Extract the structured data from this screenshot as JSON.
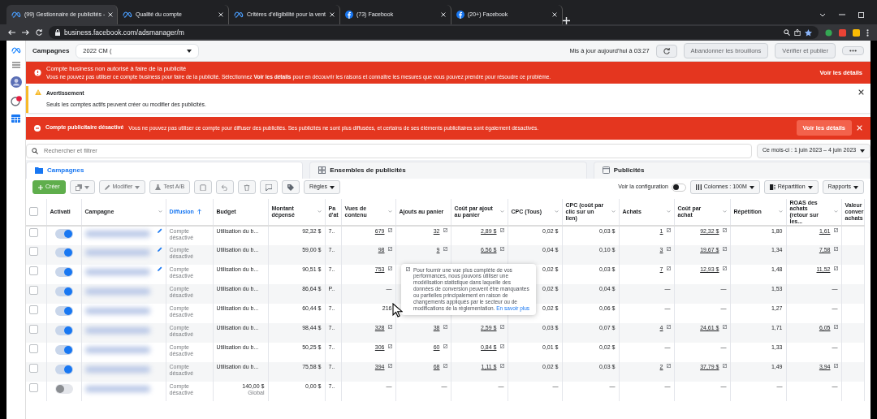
{
  "browser": {
    "tabs": [
      {
        "title": "(99) Gestionnaire de publicités -",
        "kind": "meta",
        "selected": true
      },
      {
        "title": "Qualité du compte",
        "kind": "meta",
        "selected": false
      },
      {
        "title": "Critères d'éligibilité pour la vent",
        "kind": "meta",
        "selected": false
      },
      {
        "title": "(73) Facebook",
        "kind": "facebook",
        "selected": false
      },
      {
        "title": "(20+) Facebook",
        "kind": "facebook",
        "selected": false
      }
    ],
    "url": "business.facebook.com/adsmanager/m"
  },
  "header": {
    "title": "Campagnes",
    "account": "2022 CM (",
    "updated": "Mis à jour aujourd'hui à 03:27",
    "buttons": [
      {
        "label": "Abandonner les brouillons",
        "disabled": true
      },
      {
        "label": "Vérifier et publier",
        "disabled": true
      }
    ]
  },
  "alerts": [
    {
      "kind": "error",
      "title": "Compte business non autorisé à faire de la publicité",
      "text": "Vous ne pouvez pas utiliser ce compte business pour faire de la publicité. Sélectionnez **Voir les détails** pour en découvrir les raisons et connaître les mesures que vous pouvez prendre pour résoudre ce problème.",
      "action": "Voir les détails",
      "closable": false
    },
    {
      "kind": "warning",
      "title": "Avertissement",
      "text": "Seuls les comptes actifs peuvent créer ou modifier des publicités.",
      "closable": true
    },
    {
      "kind": "error_inline",
      "title": "Compte publicitaire désactivé",
      "text": "Vous ne pouvez pas utiliser ce compte pour diffuser des publicités. Ses publicités ne sont plus diffusées, et certains de ses éléments publicitaires sont également désactivés.",
      "action": "Voir les détails",
      "closable": true
    }
  ],
  "search": {
    "placeholder": "Rechercher et filtrer",
    "date_range": "Ce mois-ci : 1 juin 2023 – 4 juin 2023"
  },
  "level_tabs": [
    {
      "label": "Campagnes",
      "kind": "folder",
      "selected": true
    },
    {
      "label": "Ensembles de publicités",
      "kind": "grid",
      "selected": false
    },
    {
      "label": "Publicités",
      "kind": "page",
      "selected": false
    }
  ],
  "toolbar": {
    "create": {
      "label": "Créer",
      "disabled": true
    },
    "edit": {
      "label": "Modifier",
      "disabled": true
    },
    "ab_test": {
      "label": "Test A/B",
      "disabled": true
    },
    "rules": "Règles",
    "config": {
      "label": "Voir la configuration",
      "on": false
    },
    "columns": "Colonnes : 100M",
    "breakdown": "Répartition",
    "reports": "Rapports"
  },
  "table": {
    "all_selected": false,
    "columns": [
      {
        "label": "Activati",
        "menu": false,
        "sorted": false
      },
      {
        "label": "Campagne",
        "menu": true,
        "sorted": false
      },
      {
        "label": "Diffusion",
        "menu": false,
        "sorted": true
      },
      {
        "label": "Budget",
        "menu": false,
        "sorted": false
      },
      {
        "label": "Montant dépensé",
        "menu": true,
        "sorted": false
      },
      {
        "label": "Pa d'at",
        "menu": false,
        "sorted": false
      },
      {
        "label": "Vues de contenu",
        "menu": true,
        "sorted": false
      },
      {
        "label": "Ajouts au panier",
        "menu": false,
        "sorted": false
      },
      {
        "label": "Coût par ajout au panier",
        "menu": true,
        "sorted": false
      },
      {
        "label": "CPC (Tous)",
        "menu": true,
        "sorted": false
      },
      {
        "label": "CPC (coût par clic sur un lien)",
        "menu": true,
        "sorted": false
      },
      {
        "label": "Achats",
        "menu": true,
        "sorted": false
      },
      {
        "label": "Coût par achat",
        "menu": true,
        "sorted": false
      },
      {
        "label": "Répétition",
        "menu": true,
        "sorted": false
      },
      {
        "label": "ROAS des achats (retour sur les...",
        "menu": true,
        "sorted": false
      },
      {
        "label": "Valeur conver achats",
        "menu": false,
        "sorted": false
      }
    ],
    "rows": [
      {
        "selected": false,
        "on": true,
        "draft": true,
        "cells": [
          null,
          null,
          "Compte désactivé",
          "Utilisation du b...",
          "92,32 $",
          "7..",
          {
            "text": "679",
            "modeled": true
          },
          {
            "text": "32",
            "modeled": true
          },
          {
            "text": "2,89 $",
            "modeled": true
          },
          "0,02 $",
          "0,03 $",
          {
            "text": "1",
            "modeled": true
          },
          {
            "text": "92,32 $",
            "modeled": true
          },
          "1,80",
          {
            "text": "1,61",
            "modeled": true
          },
          null
        ]
      },
      {
        "selected": false,
        "on": true,
        "draft": true,
        "cells": [
          null,
          null,
          "Compte désactivé",
          "Utilisation du b...",
          "59,00 $",
          "7..",
          {
            "text": "98",
            "modeled": true
          },
          {
            "text": "9",
            "modeled": true
          },
          {
            "text": "6,56 $",
            "modeled": true
          },
          "0,04 $",
          "0,10 $",
          {
            "text": "3",
            "modeled": true
          },
          {
            "text": "19,67 $",
            "modeled": true
          },
          "1,34",
          {
            "text": "7,58",
            "modeled": true
          },
          null
        ]
      },
      {
        "selected": false,
        "on": true,
        "draft": true,
        "cells": [
          null,
          null,
          "Compte désactivé",
          "Utilisation du b...",
          "90,51 $",
          "7..",
          {
            "text": "753",
            "modeled": true
          },
          null,
          null,
          "0,02 $",
          "0,03 $",
          {
            "text": "7",
            "modeled": true
          },
          {
            "text": "12,93 $",
            "modeled": true
          },
          "1,48",
          {
            "text": "11,52",
            "modeled": true
          },
          null
        ]
      },
      {
        "selected": false,
        "on": true,
        "draft": false,
        "cells": [
          null,
          null,
          "Compte désactivé",
          "Utilisation du b...",
          "86,64 $",
          "P..",
          "—",
          null,
          null,
          "0,02 $",
          "0,04 $",
          "—",
          "—",
          "1,53",
          "—",
          null
        ]
      },
      {
        "selected": false,
        "on": true,
        "draft": false,
        "cells": [
          null,
          null,
          "Compte désactivé",
          "Utilisation du b...",
          "60,44 $",
          "7..",
          {
            "text": "216",
            "modeled": false
          },
          null,
          null,
          "0,02 $",
          "0,06 $",
          "—",
          "—",
          "1,27",
          "—",
          null
        ]
      },
      {
        "selected": false,
        "on": true,
        "draft": false,
        "cells": [
          null,
          null,
          "Compte désactivé",
          "Utilisation du b...",
          "98,44 $",
          "7..",
          {
            "text": "328",
            "modeled": true
          },
          {
            "text": "38",
            "modeled": true
          },
          {
            "text": "2,59 $",
            "modeled": true
          },
          "0,03 $",
          "0,07 $",
          {
            "text": "4",
            "modeled": true
          },
          {
            "text": "24,61 $",
            "modeled": true
          },
          "1,71",
          {
            "text": "6,05",
            "modeled": true
          },
          null
        ]
      },
      {
        "selected": false,
        "on": true,
        "draft": false,
        "cells": [
          null,
          null,
          "Compte désactivé",
          "Utilisation du b...",
          "50,25 $",
          "7..",
          {
            "text": "306",
            "modeled": true
          },
          {
            "text": "60",
            "modeled": true
          },
          {
            "text": "0,84 $",
            "modeled": true
          },
          "0,01 $",
          "0,02 $",
          "—",
          "—",
          "1,33",
          "—",
          null
        ]
      },
      {
        "selected": false,
        "on": true,
        "draft": false,
        "cells": [
          null,
          null,
          "Compte désactivé",
          "Utilisation du b...",
          "75,58 $",
          "7..",
          {
            "text": "394",
            "modeled": true
          },
          {
            "text": "68",
            "modeled": true
          },
          {
            "text": "1,11 $",
            "modeled": true
          },
          "0,02 $",
          "0,03 $",
          {
            "text": "2",
            "modeled": true
          },
          {
            "text": "37,79 $",
            "modeled": true
          },
          "1,49",
          {
            "text": "3,94",
            "modeled": true
          },
          null
        ]
      },
      {
        "selected": false,
        "on": false,
        "draft": false,
        "cells": [
          null,
          null,
          "Compte désactivé",
          {
            "text": "140,00 $",
            "note": "Global"
          },
          "0,00 $",
          "7..",
          "—",
          "—",
          "—",
          "—",
          "—",
          "—",
          "—",
          "—",
          "—",
          null
        ]
      }
    ],
    "tooltip": {
      "text": "Pour fournir une vue plus complète de vos performances, nous pouvons utiliser une modélisation statistique dans laquelle des données de conversion peuvent être manquantes ou partielles principalement en raison de changements appliqués par le secteur ou de modifications de la réglementation.",
      "link": "En savoir plus"
    }
  }
}
